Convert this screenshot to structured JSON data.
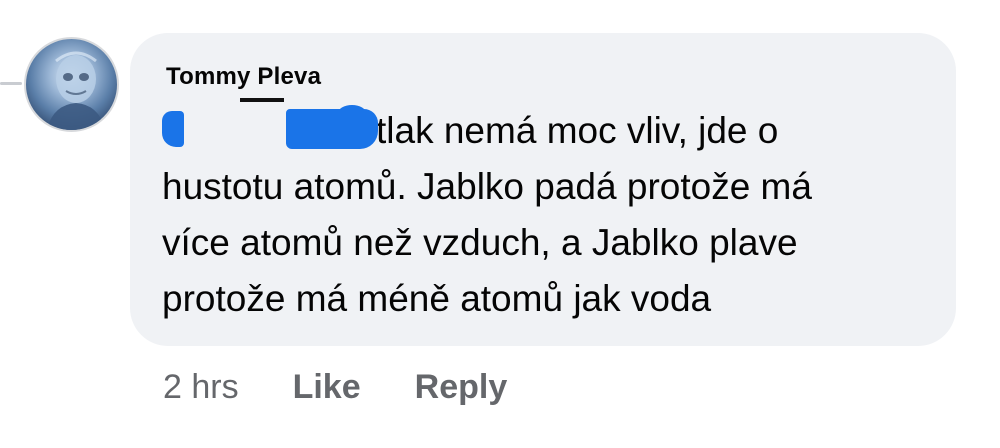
{
  "comment": {
    "author": "Tommy Pleva",
    "text_lines": [
      "tlak nemá moc vliv, jde o",
      "hustotu atomů. Jablko padá protože má",
      "více atomů než vzduch, a Jablko plave",
      "protože má méně atomů jak voda"
    ],
    "timestamp": "2 hrs",
    "like_label": "Like",
    "reply_label": "Reply"
  },
  "colors": {
    "bubble_bg": "#f0f2f5",
    "redaction": "#1a74e8",
    "text": "#050505",
    "meta_text": "#65676b"
  },
  "icons": {
    "avatar": "profile-photo-icon"
  }
}
